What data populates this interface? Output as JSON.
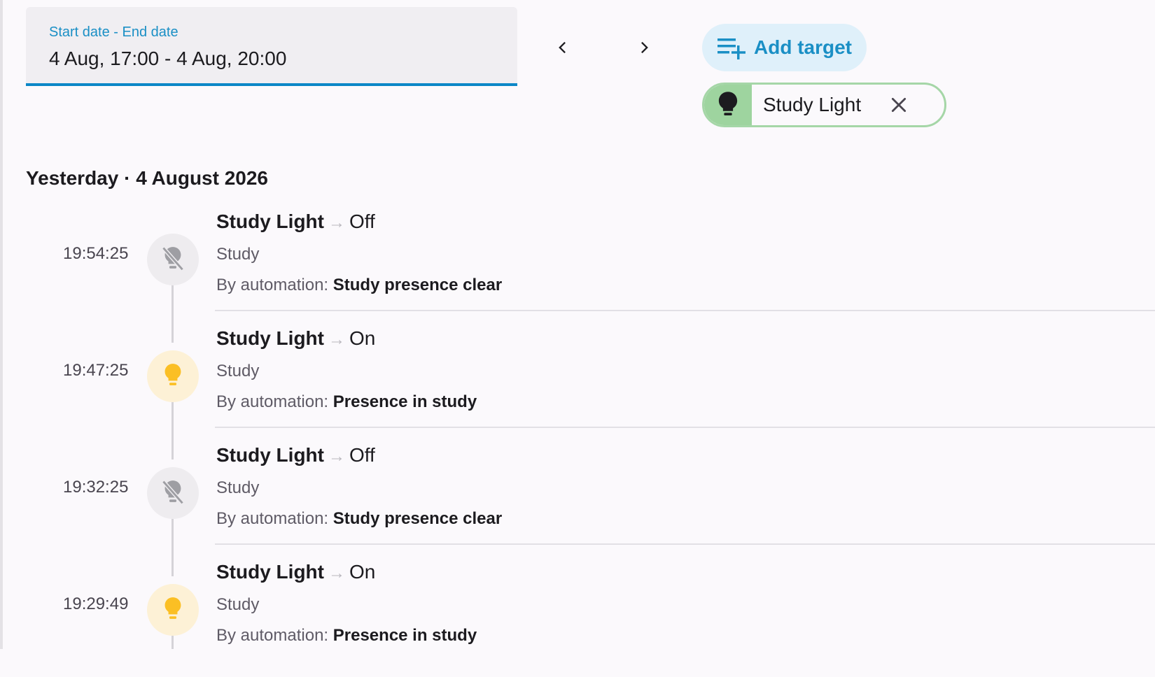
{
  "date_range": {
    "label": "Start date - End date",
    "value": "4 Aug, 17:00 - 4 Aug, 20:00"
  },
  "nav": {
    "prev_icon": "chevron-left-icon",
    "next_icon": "chevron-right-icon"
  },
  "add_target": {
    "label": "Add target",
    "icon": "playlist-plus-icon"
  },
  "target_chip": {
    "label": "Study Light",
    "icon": "lightbulb-icon",
    "close_icon": "close-icon"
  },
  "day_heading": "Yesterday · 4 August 2026",
  "entries": [
    {
      "time": "19:54:25",
      "name": "Study Light",
      "arrow": "→",
      "state": "Off",
      "area": "Study",
      "by_prefix": "By automation: ",
      "automation": "Study presence clear",
      "icon": "lightbulb-off-icon"
    },
    {
      "time": "19:47:25",
      "name": "Study Light",
      "arrow": "→",
      "state": "On",
      "area": "Study",
      "by_prefix": "By automation: ",
      "automation": "Presence in study",
      "icon": "lightbulb-icon"
    },
    {
      "time": "19:32:25",
      "name": "Study Light",
      "arrow": "→",
      "state": "Off",
      "area": "Study",
      "by_prefix": "By automation: ",
      "automation": "Study presence clear",
      "icon": "lightbulb-off-icon"
    },
    {
      "time": "19:29:49",
      "name": "Study Light",
      "arrow": "→",
      "state": "On",
      "area": "Study",
      "by_prefix": "By automation: ",
      "automation": "Presence in study",
      "icon": "lightbulb-icon"
    }
  ],
  "colors": {
    "accent": "#0b87c7",
    "light_on": "#fbbf24",
    "light_off": "#9e9ea3",
    "chip_border": "#a5d6a7"
  }
}
